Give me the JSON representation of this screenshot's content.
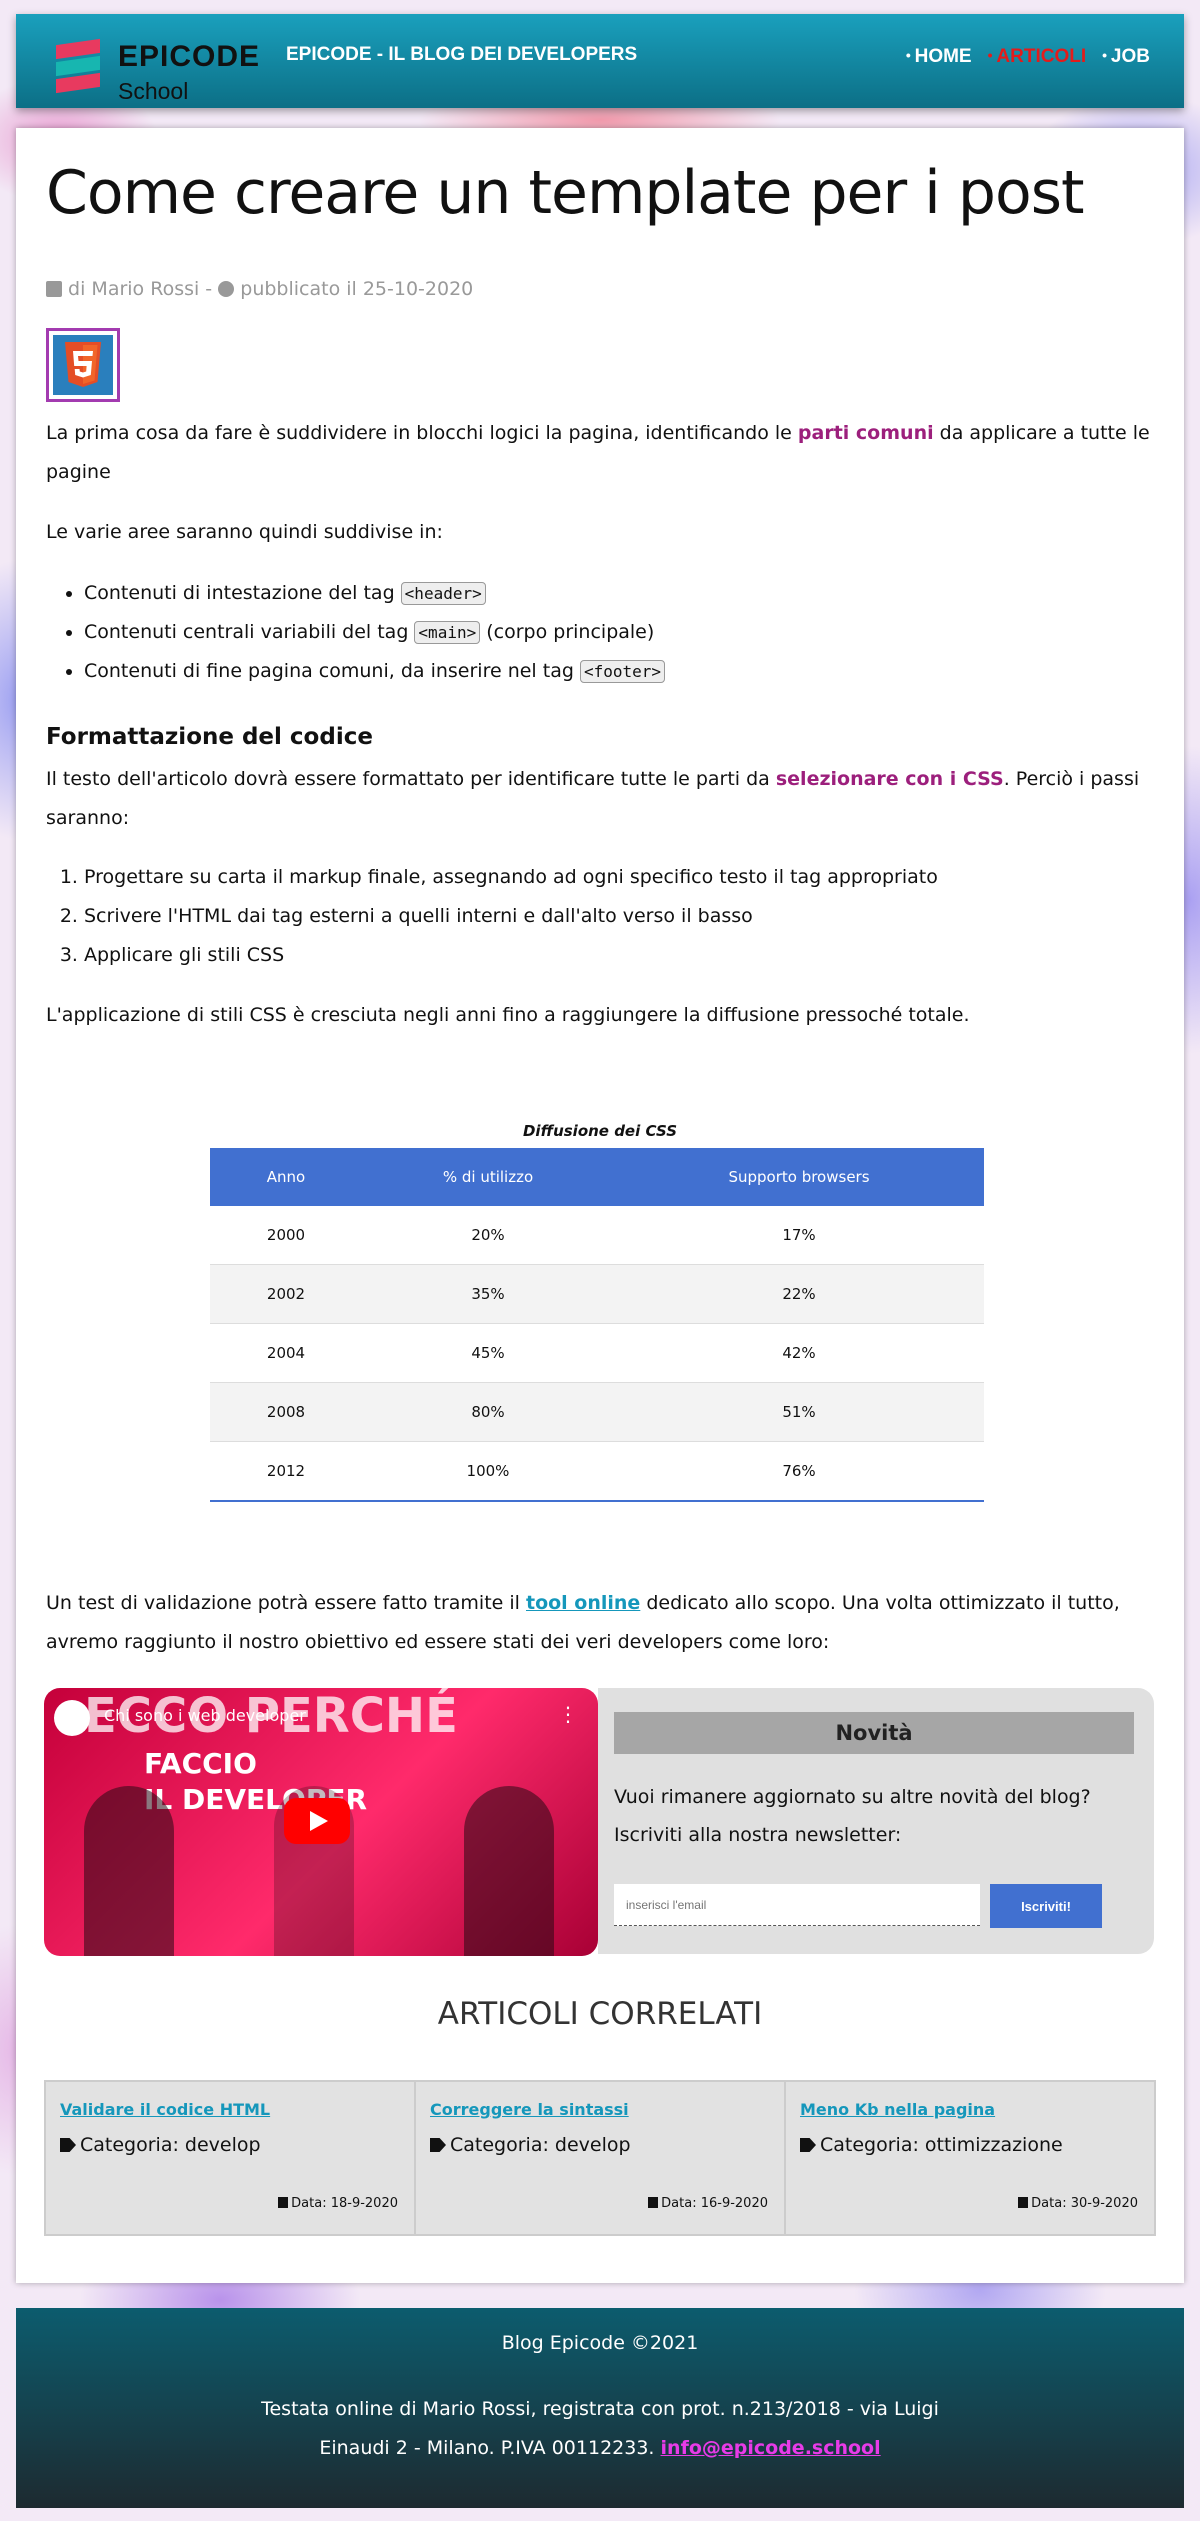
{
  "header": {
    "logo_name": "EPICODE",
    "logo_sub": "School",
    "site_title": "EPICODE - IL BLOG DEI DEVELOPERS",
    "nav": [
      "HOME",
      "ARTICOLI",
      "JOB"
    ],
    "active_nav": "ARTICOLI"
  },
  "article": {
    "title": "Come creare un template per i post",
    "meta_author": "di Mario Rossi -",
    "meta_date": "pubblicato il 25-10-2020",
    "p1_a": "La prima cosa da fare è suddividere in blocchi logici la pagina, identificando le ",
    "p1_hl": "parti comuni",
    "p1_b": " da applicare a tutte le pagine",
    "p2": "Le varie aree saranno quindi suddivise in:",
    "areas": [
      {
        "pre": "Contenuti di intestazione del tag ",
        "code": "<header>",
        "post": ""
      },
      {
        "pre": "Contenuti centrali variabili del tag ",
        "code": "<main>",
        "post": " (corpo principale)"
      },
      {
        "pre": "Contenuti di fine pagina comuni, da inserire nel tag ",
        "code": "<footer>",
        "post": ""
      }
    ],
    "h_format": "Formattazione del codice",
    "p3_a": "Il testo dell'articolo dovrà essere formattato per identificare tutte le parti da ",
    "p3_hl": "selezionare con i CSS",
    "p3_b": ". Perciò i passi saranno:",
    "steps": [
      "Progettare su carta il markup finale, assegnando ad ogni specifico testo il tag appropriato",
      "Scrivere l'HTML dai tag esterni a quelli interni e dall'alto verso il basso",
      "Applicare gli stili CSS"
    ],
    "p4": "L'applicazione di stili CSS è cresciuta negli anni fino a raggiungere la diffusione pressoché totale.",
    "p5_a": "Un test di validazione potrà essere fatto tramite il ",
    "p5_link": "tool online",
    "p5_b": " dedicato allo scopo. Una volta ottimizzato il tutto, avremo raggiunto il nostro obiettivo ed essere stati dei veri developers come loro:"
  },
  "table": {
    "caption": "Diffusione dei CSS",
    "headers": [
      "Anno",
      "% di utilizzo",
      "Supporto browsers"
    ],
    "rows": [
      [
        "2000",
        "20%",
        "17%"
      ],
      [
        "2002",
        "35%",
        "22%"
      ],
      [
        "2004",
        "45%",
        "42%"
      ],
      [
        "2008",
        "80%",
        "51%"
      ],
      [
        "2012",
        "100%",
        "76%"
      ]
    ]
  },
  "video": {
    "title": "Chi sono i web developer",
    "overlay_1": "ECCO PERCHÉ",
    "overlay_2": "FACCIO",
    "overlay_3": "IL DEVELOPER"
  },
  "newsletter": {
    "heading": "Novità",
    "text": "Vuoi rimanere aggiornato su altre novità del blog? Iscriviti alla nostra newsletter:",
    "placeholder": "inserisci l'email",
    "button": "Iscriviti!"
  },
  "related": {
    "heading": "ARTICOLI CORRELATI",
    "items": [
      {
        "title": "Validare il codice HTML",
        "category": "Categoria: develop",
        "date": "Data: 18-9-2020"
      },
      {
        "title": "Correggere la sintassi",
        "category": "Categoria: develop",
        "date": "Data: 16-9-2020"
      },
      {
        "title": "Meno Kb nella pagina",
        "category": "Categoria: ottimizzazione",
        "date": "Data: 30-9-2020"
      }
    ]
  },
  "footer": {
    "line1": "Blog Epicode ©2021",
    "line2_a": "Testata online di Mario Rossi, registrata con prot. n.213/2018 - via Luigi",
    "line2_b": "Einaudi 2 - Milano. P.IVA 00112233.",
    "email": "info@epicode.school"
  }
}
